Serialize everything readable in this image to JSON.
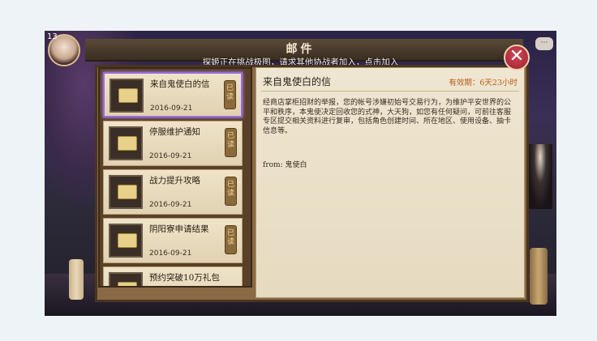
{
  "hud": {
    "level": "13",
    "chat_icon": "chat-bubble-icon"
  },
  "window": {
    "title": "邮件",
    "notice": "探姬正在挑战极图，请求其他协战者加入，点击加入",
    "close_icon": "close-icon"
  },
  "mail_list": [
    {
      "title": "来自鬼使白的信",
      "date": "2016-09-21",
      "status": "已读",
      "selected": true
    },
    {
      "title": "停服维护通知",
      "date": "2016-09-21",
      "status": "已读",
      "selected": false
    },
    {
      "title": "战力提升攻略",
      "date": "2016-09-21",
      "status": "已读",
      "selected": false
    },
    {
      "title": "阴阳寮申请结果",
      "date": "2016-09-21",
      "status": "已读",
      "selected": false
    },
    {
      "title": "预约突破10万礼包",
      "date": "",
      "status": "",
      "selected": false
    }
  ],
  "detail": {
    "title": "来自鬼使白的信",
    "validity": "有效期：6天23小时",
    "body": "经商店掌柜招财的举报，您的帐号涉嫌初始号交易行为，为维护平安世界的公平和秩序，本鬼使决定回收您的式神，大天狗，如您有任何疑问，可前往客服专区提交相关资料进行复审，包括角色创建时间、所在地区、使用设备、抽卡信息等。",
    "from": "from: 鬼使白"
  }
}
